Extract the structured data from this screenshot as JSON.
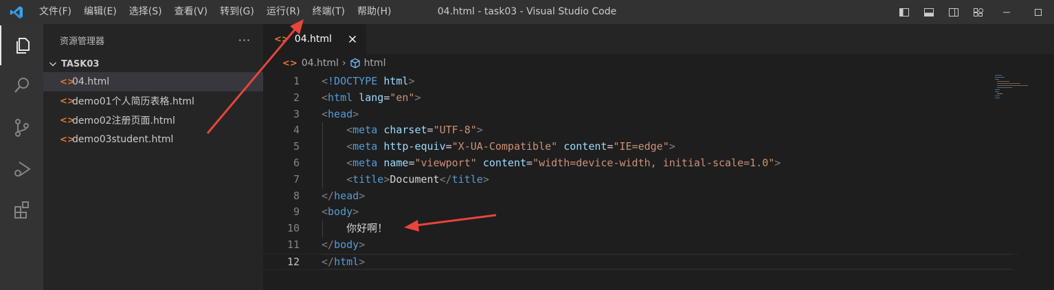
{
  "app": {
    "window_title": "04.html - task03 - Visual Studio Code"
  },
  "menu": {
    "items": [
      {
        "id": "file",
        "label": "文件(F)"
      },
      {
        "id": "edit",
        "label": "编辑(E)"
      },
      {
        "id": "selection",
        "label": "选择(S)"
      },
      {
        "id": "view",
        "label": "查看(V)"
      },
      {
        "id": "goto",
        "label": "转到(G)"
      },
      {
        "id": "run",
        "label": "运行(R)"
      },
      {
        "id": "terminal",
        "label": "终端(T)"
      },
      {
        "id": "help",
        "label": "帮助(H)"
      }
    ]
  },
  "sidebar": {
    "title": "资源管理器",
    "folder": "TASK03",
    "files": [
      {
        "name": "04.html",
        "selected": true
      },
      {
        "name": "demo01个人简历表格.html",
        "selected": false
      },
      {
        "name": "demo02注册页面.html",
        "selected": false
      },
      {
        "name": "demo03student.html",
        "selected": false
      }
    ]
  },
  "editor": {
    "tab_label": "04.html",
    "breadcrumb": {
      "file": "04.html",
      "symbol": "html"
    },
    "current_line": 12,
    "lines": [
      {
        "n": "1",
        "indent": 0,
        "tokens": [
          [
            "punc",
            "<"
          ],
          [
            "tag",
            "!DOCTYPE"
          ],
          [
            "text",
            " "
          ],
          [
            "attr",
            "html"
          ],
          [
            "punc",
            ">"
          ]
        ]
      },
      {
        "n": "2",
        "indent": 0,
        "tokens": [
          [
            "punc",
            "<"
          ],
          [
            "tag",
            "html"
          ],
          [
            "text",
            " "
          ],
          [
            "attr",
            "lang"
          ],
          [
            "text",
            "="
          ],
          [
            "str",
            "\"en\""
          ],
          [
            "punc",
            ">"
          ]
        ]
      },
      {
        "n": "3",
        "indent": 0,
        "tokens": [
          [
            "punc",
            "<"
          ],
          [
            "tag",
            "head"
          ],
          [
            "punc",
            ">"
          ]
        ]
      },
      {
        "n": "4",
        "indent": 1,
        "tokens": [
          [
            "text",
            "    "
          ],
          [
            "punc",
            "<"
          ],
          [
            "tag",
            "meta"
          ],
          [
            "text",
            " "
          ],
          [
            "attr",
            "charset"
          ],
          [
            "text",
            "="
          ],
          [
            "str",
            "\"UTF-8\""
          ],
          [
            "punc",
            ">"
          ]
        ]
      },
      {
        "n": "5",
        "indent": 1,
        "tokens": [
          [
            "text",
            "    "
          ],
          [
            "punc",
            "<"
          ],
          [
            "tag",
            "meta"
          ],
          [
            "text",
            " "
          ],
          [
            "attr",
            "http-equiv"
          ],
          [
            "text",
            "="
          ],
          [
            "str",
            "\"X-UA-Compatible\""
          ],
          [
            "text",
            " "
          ],
          [
            "attr",
            "content"
          ],
          [
            "text",
            "="
          ],
          [
            "str",
            "\"IE=edge\""
          ],
          [
            "punc",
            ">"
          ]
        ]
      },
      {
        "n": "6",
        "indent": 1,
        "tokens": [
          [
            "text",
            "    "
          ],
          [
            "punc",
            "<"
          ],
          [
            "tag",
            "meta"
          ],
          [
            "text",
            " "
          ],
          [
            "attr",
            "name"
          ],
          [
            "text",
            "="
          ],
          [
            "str",
            "\"viewport\""
          ],
          [
            "text",
            " "
          ],
          [
            "attr",
            "content"
          ],
          [
            "text",
            "="
          ],
          [
            "str",
            "\"width=device-width, initial-scale=1.0\""
          ],
          [
            "punc",
            ">"
          ]
        ]
      },
      {
        "n": "7",
        "indent": 1,
        "tokens": [
          [
            "text",
            "    "
          ],
          [
            "punc",
            "<"
          ],
          [
            "tag",
            "title"
          ],
          [
            "punc",
            ">"
          ],
          [
            "text",
            "Document"
          ],
          [
            "punc",
            "</"
          ],
          [
            "tag",
            "title"
          ],
          [
            "punc",
            ">"
          ]
        ]
      },
      {
        "n": "8",
        "indent": 0,
        "tokens": [
          [
            "punc",
            "</"
          ],
          [
            "tag",
            "head"
          ],
          [
            "punc",
            ">"
          ]
        ]
      },
      {
        "n": "9",
        "indent": 0,
        "tokens": [
          [
            "punc",
            "<"
          ],
          [
            "tag",
            "body"
          ],
          [
            "punc",
            ">"
          ]
        ]
      },
      {
        "n": "10",
        "indent": 1,
        "tokens": [
          [
            "text",
            "    你好啊！"
          ]
        ]
      },
      {
        "n": "11",
        "indent": 0,
        "tokens": [
          [
            "punc",
            "</"
          ],
          [
            "tag",
            "body"
          ],
          [
            "punc",
            ">"
          ]
        ]
      },
      {
        "n": "12",
        "indent": 0,
        "tokens": [
          [
            "punc",
            "</"
          ],
          [
            "tag",
            "html"
          ],
          [
            "punc",
            ">"
          ]
        ]
      }
    ]
  },
  "colors": {
    "accent": "#007acc",
    "annotation_arrow": "#e8453c",
    "html_file_icon": "#e37933"
  },
  "icons": {
    "app": "vscode-logo-icon",
    "activity": [
      "explorer-icon",
      "search-icon",
      "source-control-icon",
      "run-debug-icon",
      "extensions-icon"
    ]
  }
}
